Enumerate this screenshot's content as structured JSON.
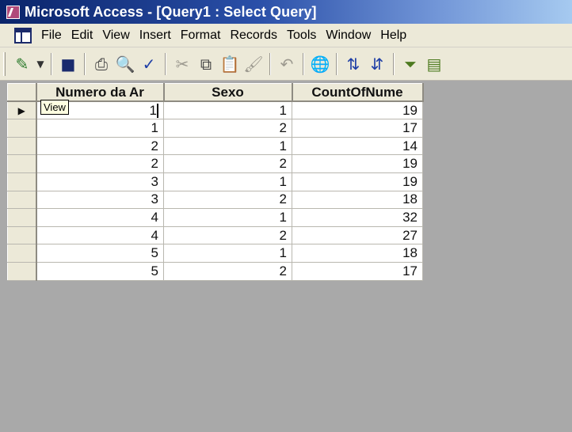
{
  "window": {
    "title": "Microsoft Access - [Query1 : Select Query]"
  },
  "menu": [
    "File",
    "Edit",
    "View",
    "Insert",
    "Format",
    "Records",
    "Tools",
    "Window",
    "Help"
  ],
  "toolbar": {
    "icons": [
      "view-icon",
      "dropdown-arrow-icon",
      "save-icon",
      "print-icon",
      "print-preview-icon",
      "spelling-icon",
      "cut-icon",
      "copy-icon",
      "paste-icon",
      "format-painter-icon",
      "undo-icon",
      "web-icon",
      "sort-ascending-icon",
      "sort-descending-icon",
      "filter-by-selection-icon",
      "filter-by-form-icon"
    ]
  },
  "tooltip": {
    "text": "View"
  },
  "grid": {
    "columns": [
      "Numero da Ar",
      "Sexo",
      "CountOfNume"
    ],
    "rows": [
      [
        "1",
        "1",
        "19"
      ],
      [
        "1",
        "2",
        "17"
      ],
      [
        "2",
        "1",
        "14"
      ],
      [
        "2",
        "2",
        "19"
      ],
      [
        "3",
        "1",
        "19"
      ],
      [
        "3",
        "2",
        "18"
      ],
      [
        "4",
        "1",
        "32"
      ],
      [
        "4",
        "2",
        "27"
      ],
      [
        "5",
        "1",
        "18"
      ],
      [
        "5",
        "2",
        "17"
      ]
    ],
    "current_row_indicator": "▶"
  },
  "colors": {
    "title_gradient_start": "#0a246a",
    "title_gradient_end": "#a6caf0",
    "workspace": "#a9a9a9",
    "chrome": "#ece9d8"
  }
}
